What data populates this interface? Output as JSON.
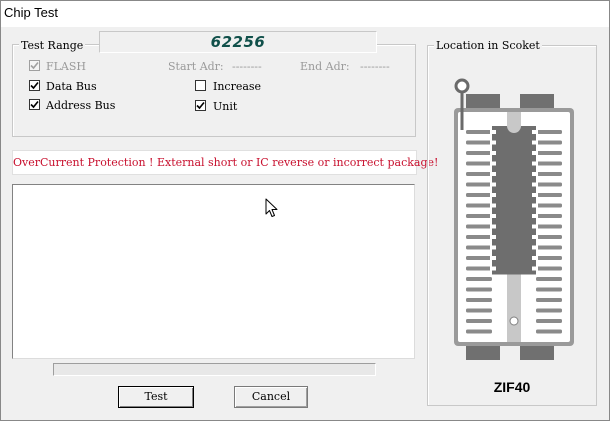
{
  "window": {
    "title": "Chip Test"
  },
  "chip": {
    "name": "62256"
  },
  "test_range": {
    "legend": "Test Range",
    "flash": {
      "label": "FLASH",
      "checked": true,
      "enabled": false
    },
    "data_bus": {
      "label": "Data Bus",
      "checked": true
    },
    "address_bus": {
      "label": "Address Bus",
      "checked": true
    },
    "start_adr": {
      "label": "Start Adr:",
      "value": "--------"
    },
    "end_adr": {
      "label": "End Adr:",
      "value": "--------"
    },
    "increase": {
      "label": "Increase",
      "checked": false
    },
    "unit": {
      "label": "Unit",
      "checked": true
    }
  },
  "status": {
    "message": "OverCurrent Protection ! External short or IC reverse or incorrect package!",
    "color": "#c8102e"
  },
  "progress": {
    "fraction": 0
  },
  "buttons": {
    "test": "Test",
    "cancel": "Cancel"
  },
  "socket": {
    "legend": "Location in Scoket",
    "type": "ZIF40",
    "pins_per_side": 20,
    "chip_pins_per_side": 14
  },
  "colors": {
    "chip_text": "#10504a",
    "socket_gray": "#808080",
    "chip_body": "#6e6e6e"
  }
}
